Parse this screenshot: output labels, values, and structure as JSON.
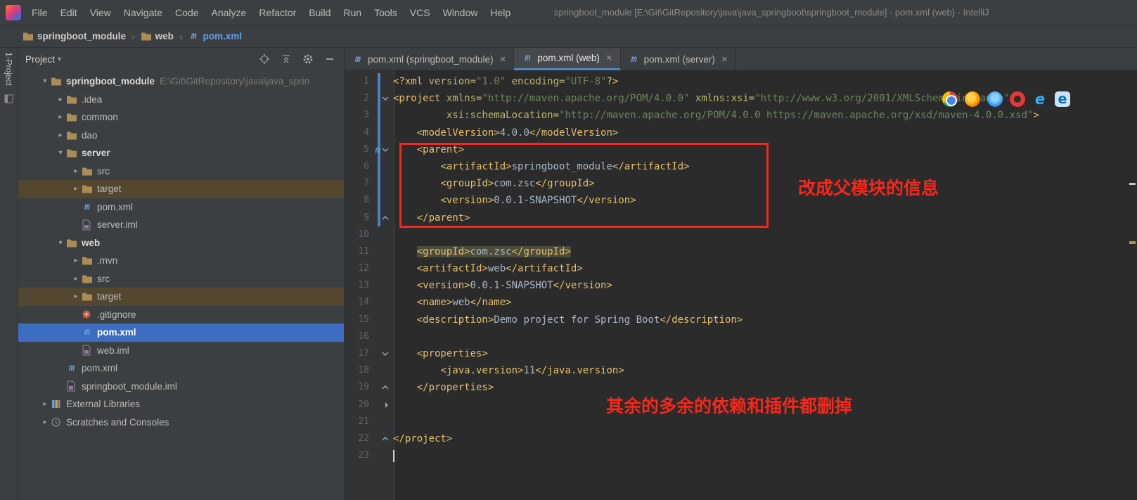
{
  "window": {
    "title": "springboot_module [E:\\Git\\GitRepository\\java\\java_springboot\\springboot_module] - pom.xml (web) - IntelliJ",
    "menu": [
      "File",
      "Edit",
      "View",
      "Navigate",
      "Code",
      "Analyze",
      "Refactor",
      "Build",
      "Run",
      "Tools",
      "VCS",
      "Window",
      "Help"
    ]
  },
  "breadcrumbs": {
    "separator": "›",
    "items": [
      {
        "label": "springboot_module",
        "icon": "folder"
      },
      {
        "label": "web",
        "icon": "folder"
      },
      {
        "label": "pom.xml",
        "icon": "maven",
        "accent": true
      }
    ]
  },
  "tool_stripe": {
    "label": "1-Project"
  },
  "project_panel": {
    "title": "Project",
    "tree": [
      {
        "label": "springboot_module",
        "path": "E:\\Git\\GitRepository\\java\\java_sprin",
        "level": 0,
        "icon": "folder",
        "arrow": "open",
        "bold": true
      },
      {
        "label": ".idea",
        "level": 1,
        "icon": "folder",
        "arrow": "closed"
      },
      {
        "label": "common",
        "level": 1,
        "icon": "folder",
        "arrow": "closed"
      },
      {
        "label": "dao",
        "level": 1,
        "icon": "folder",
        "arrow": "closed"
      },
      {
        "label": "server",
        "level": 1,
        "icon": "folder",
        "arrow": "open",
        "bold": true
      },
      {
        "label": "src",
        "level": 2,
        "icon": "folder",
        "arrow": "closed"
      },
      {
        "label": "target",
        "level": 2,
        "icon": "folder",
        "arrow": "closed",
        "excluded": true
      },
      {
        "label": "pom.xml",
        "level": 2,
        "icon": "maven"
      },
      {
        "label": "server.iml",
        "level": 2,
        "icon": "iml"
      },
      {
        "label": "web",
        "level": 1,
        "icon": "folder",
        "arrow": "open",
        "bold": true
      },
      {
        "label": ".mvn",
        "level": 2,
        "icon": "folder",
        "arrow": "closed"
      },
      {
        "label": "src",
        "level": 2,
        "icon": "folder",
        "arrow": "closed"
      },
      {
        "label": "target",
        "level": 2,
        "icon": "folder",
        "arrow": "closed",
        "excluded": true
      },
      {
        "label": ".gitignore",
        "level": 2,
        "icon": "gitignore"
      },
      {
        "label": "pom.xml",
        "level": 2,
        "icon": "maven",
        "selected": true
      },
      {
        "label": "web.iml",
        "level": 2,
        "icon": "iml"
      },
      {
        "label": "pom.xml",
        "level": 1,
        "icon": "maven"
      },
      {
        "label": "springboot_module.iml",
        "level": 1,
        "icon": "iml"
      },
      {
        "label": "External Libraries",
        "level": 0,
        "icon": "libraries",
        "arrow": "closed"
      },
      {
        "label": "Scratches and Consoles",
        "level": 0,
        "icon": "scratches",
        "arrow": "closed"
      }
    ]
  },
  "editor": {
    "tabs": [
      {
        "label": "pom.xml (springboot_module)",
        "active": false
      },
      {
        "label": "pom.xml (web)",
        "active": true
      },
      {
        "label": "pom.xml (server)",
        "active": false
      }
    ],
    "lines": [
      {
        "n": 1,
        "tokens": [
          [
            "t",
            "<?xml "
          ],
          [
            "a",
            "version="
          ],
          [
            "s",
            "\"1.0\""
          ],
          [
            "p",
            " "
          ],
          [
            "a",
            "encoding="
          ],
          [
            "s",
            "\"UTF-8\""
          ],
          [
            "t",
            "?>"
          ]
        ]
      },
      {
        "n": 2,
        "fold": "down",
        "tokens": [
          [
            "t",
            "<project "
          ],
          [
            "a",
            "xmlns="
          ],
          [
            "s",
            "\"http://maven.apache.org/POM/4.0.0\""
          ],
          [
            "p",
            " "
          ],
          [
            "a",
            "xmlns:xsi="
          ],
          [
            "s",
            "\"http://www.w3.org/2001/XMLSchema-instance\""
          ]
        ]
      },
      {
        "n": 3,
        "tokens": [
          [
            "p",
            "         "
          ],
          [
            "a",
            "xsi:schemaLocation="
          ],
          [
            "s",
            "\"http://maven.apache.org/POM/4.0.0 https://maven.apache.org/xsd/maven-4.0.0.xsd\""
          ],
          [
            "t",
            ">"
          ]
        ]
      },
      {
        "n": 4,
        "tokens": [
          [
            "p",
            "    "
          ],
          [
            "t",
            "<modelVersion>"
          ],
          [
            "x",
            "4.0.0"
          ],
          [
            "t",
            "</modelVersion>"
          ]
        ]
      },
      {
        "n": 5,
        "fold": "down",
        "gicon": "maven",
        "tokens": [
          [
            "p",
            "    "
          ],
          [
            "t",
            "<parent>"
          ]
        ]
      },
      {
        "n": 6,
        "tokens": [
          [
            "p",
            "        "
          ],
          [
            "t",
            "<artifactId>"
          ],
          [
            "x",
            "springboot_module"
          ],
          [
            "t",
            "</artifactId>"
          ]
        ]
      },
      {
        "n": 7,
        "tokens": [
          [
            "p",
            "        "
          ],
          [
            "t",
            "<groupId>"
          ],
          [
            "x",
            "com.zsc"
          ],
          [
            "t",
            "</groupId>"
          ]
        ]
      },
      {
        "n": 8,
        "tokens": [
          [
            "p",
            "        "
          ],
          [
            "t",
            "<version>"
          ],
          [
            "x",
            "0.0.1-SNAPSHOT"
          ],
          [
            "t",
            "</version>"
          ]
        ]
      },
      {
        "n": 9,
        "fold": "up",
        "tokens": [
          [
            "p",
            "    "
          ],
          [
            "t",
            "</parent>"
          ]
        ]
      },
      {
        "n": 10,
        "tokens": []
      },
      {
        "n": 11,
        "hl": true,
        "tokens": [
          [
            "p",
            "    "
          ],
          [
            "t",
            "<groupId>"
          ],
          [
            "x",
            "com.zsc"
          ],
          [
            "t",
            "</groupId>"
          ]
        ]
      },
      {
        "n": 12,
        "tokens": [
          [
            "p",
            "    "
          ],
          [
            "t",
            "<artifactId>"
          ],
          [
            "x",
            "web"
          ],
          [
            "t",
            "</artifactId>"
          ]
        ]
      },
      {
        "n": 13,
        "tokens": [
          [
            "p",
            "    "
          ],
          [
            "t",
            "<version>"
          ],
          [
            "x",
            "0.0.1-SNAPSHOT"
          ],
          [
            "t",
            "</version>"
          ]
        ]
      },
      {
        "n": 14,
        "tokens": [
          [
            "p",
            "    "
          ],
          [
            "t",
            "<name>"
          ],
          [
            "x",
            "web"
          ],
          [
            "t",
            "</name>"
          ]
        ]
      },
      {
        "n": 15,
        "tokens": [
          [
            "p",
            "    "
          ],
          [
            "t",
            "<description>"
          ],
          [
            "x",
            "Demo project for Spring Boot"
          ],
          [
            "t",
            "</description>"
          ]
        ]
      },
      {
        "n": 16,
        "tokens": []
      },
      {
        "n": 17,
        "fold": "down",
        "tokens": [
          [
            "p",
            "    "
          ],
          [
            "t",
            "<properties>"
          ]
        ]
      },
      {
        "n": 18,
        "tokens": [
          [
            "p",
            "        "
          ],
          [
            "t",
            "<java.version>"
          ],
          [
            "x",
            "11"
          ],
          [
            "t",
            "</java.version>"
          ]
        ]
      },
      {
        "n": 19,
        "fold": "up",
        "tokens": [
          [
            "p",
            "    "
          ],
          [
            "t",
            "</properties>"
          ]
        ]
      },
      {
        "n": 20,
        "fold": "right",
        "tokens": []
      },
      {
        "n": 21,
        "tokens": []
      },
      {
        "n": 22,
        "fold": "up",
        "tokens": [
          [
            "t",
            "</project>"
          ]
        ]
      },
      {
        "n": 23,
        "caret": true,
        "tokens": []
      }
    ]
  },
  "overlay": {
    "note_parent": "改成父模块的信息",
    "note_bottom": "其余的多余的依赖和插件都删掉",
    "browsers": [
      "chrome",
      "firefox",
      "safari",
      "opera",
      "ie",
      "edge"
    ]
  },
  "colors": {
    "annotation_red": "#F5281B",
    "tree_selection_blue": "#3D6DC1",
    "excluded_row_brown": "#53472F",
    "vcs_change_blue": "#4C7FBE",
    "xml_tag": "#E8BF6A",
    "xml_attribute": "#BDB76B",
    "xml_string": "#6A8759",
    "xml_text": "#A9B7C6",
    "editor_bg": "#2B2B2B",
    "panel_bg": "#3C3F41"
  }
}
